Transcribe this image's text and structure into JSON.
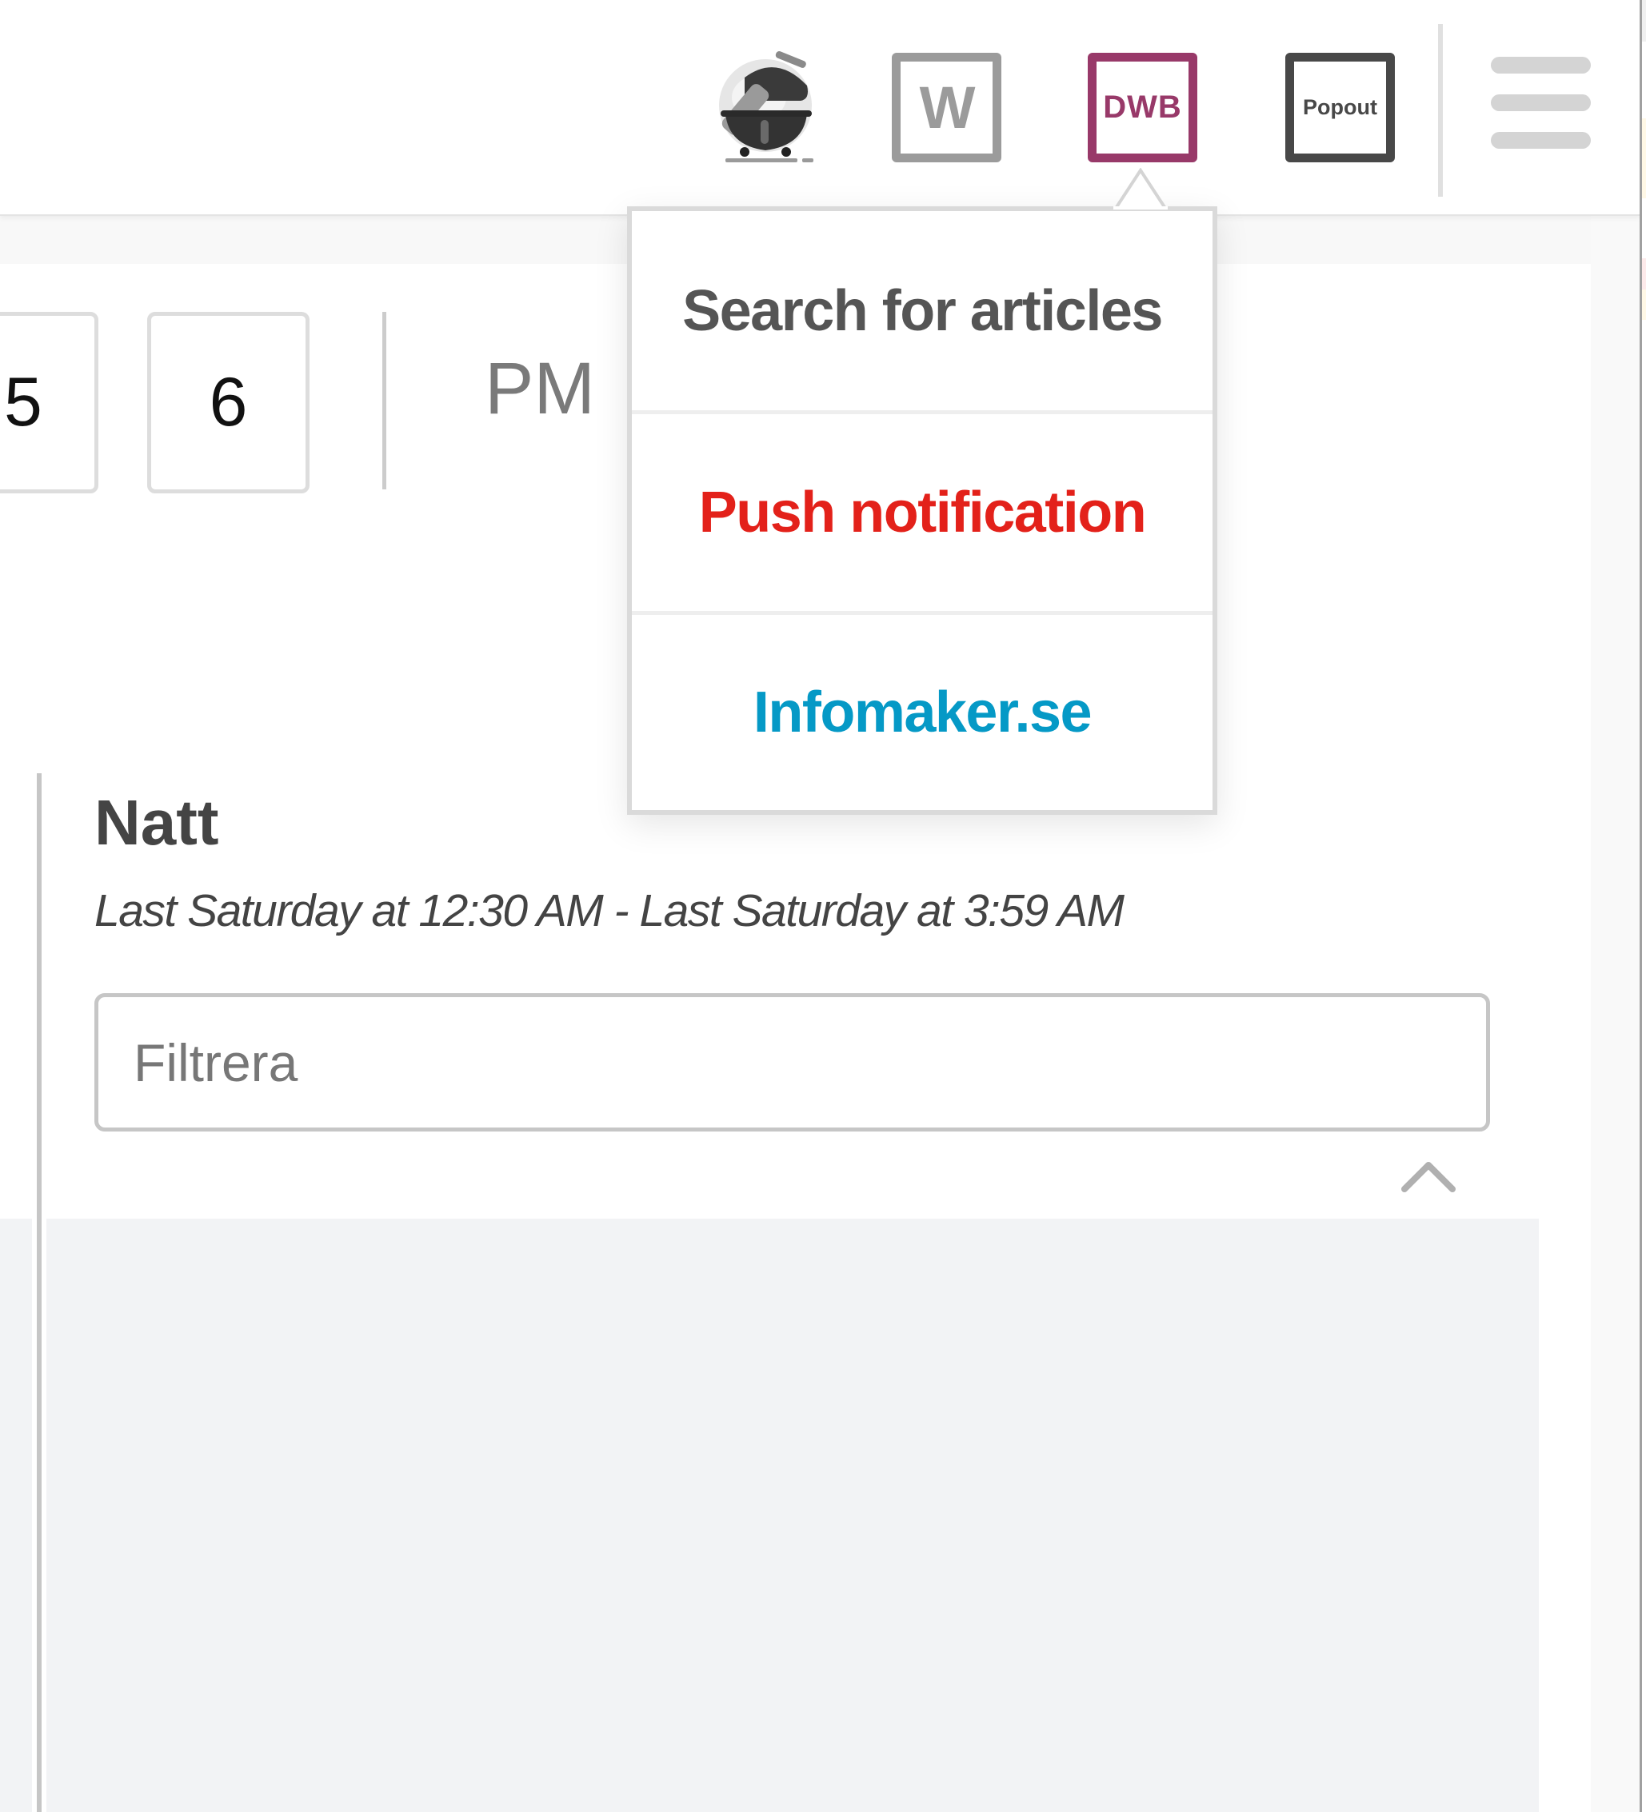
{
  "header": {
    "toolbar_icons": [
      {
        "name": "grill",
        "label": ""
      },
      {
        "name": "w",
        "label": "W"
      },
      {
        "name": "dwb",
        "label": "DWB"
      },
      {
        "name": "popout",
        "label": "Popout"
      }
    ],
    "menu_icon": "hamburger-menu-icon"
  },
  "colors": {
    "dwb_accent": "#983969",
    "push_notification": "#e3211a",
    "infomaker_link": "#0599c6",
    "search_text": "#555555"
  },
  "time_picker": {
    "hours_visible": [
      "5",
      "6"
    ],
    "meridiem": "PM"
  },
  "event": {
    "title": "Natt",
    "date_range": "Last Saturday at 12:30 AM - Last Saturday at 3:59 AM"
  },
  "filter": {
    "value": "",
    "placeholder": "Filtrera"
  },
  "popover_menu": {
    "items": [
      {
        "label": "Search for articles"
      },
      {
        "label": "Push notification"
      },
      {
        "label": "Infomaker.se"
      }
    ]
  }
}
